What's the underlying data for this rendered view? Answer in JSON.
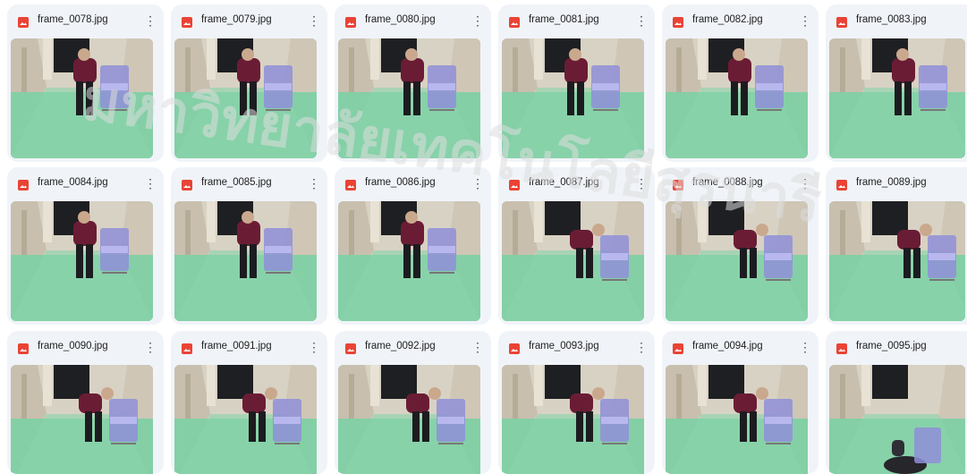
{
  "files": [
    {
      "name": "frame_0078.jpg"
    },
    {
      "name": "frame_0079.jpg"
    },
    {
      "name": "frame_0080.jpg"
    },
    {
      "name": "frame_0081.jpg"
    },
    {
      "name": "frame_0082.jpg"
    },
    {
      "name": "frame_0083.jpg"
    },
    {
      "name": "frame_0084.jpg"
    },
    {
      "name": "frame_0085.jpg"
    },
    {
      "name": "frame_0086.jpg"
    },
    {
      "name": "frame_0087.jpg"
    },
    {
      "name": "frame_0088.jpg"
    },
    {
      "name": "frame_0089.jpg"
    },
    {
      "name": "frame_0090.jpg"
    },
    {
      "name": "frame_0091.jpg"
    },
    {
      "name": "frame_0092.jpg"
    },
    {
      "name": "frame_0093.jpg"
    },
    {
      "name": "frame_0094.jpg"
    },
    {
      "name": "frame_0095.jpg"
    }
  ],
  "more_glyph": "⋮",
  "icons": {
    "file": "image-file-icon",
    "more": "more-vert-icon"
  },
  "colors": {
    "file_icon": "#ea4335",
    "card_bg": "#f0f4f9",
    "floor": "#7fcaa0",
    "wall": "#d8d2c4"
  },
  "watermark": "มหาวิทยาลัยเทคโนโลยีสุรนารี"
}
